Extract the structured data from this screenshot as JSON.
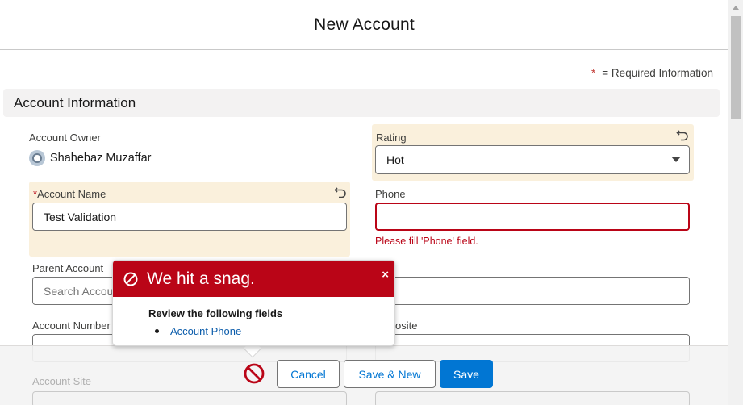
{
  "modal": {
    "title": "New Account"
  },
  "required_info": {
    "star": "*",
    "text": "= Required Information"
  },
  "section": {
    "title": "Account Information"
  },
  "fields": {
    "account_owner": {
      "label": "Account Owner",
      "value": "Shahebaz Muzaffar"
    },
    "rating": {
      "label": "Rating",
      "value": "Hot"
    },
    "account_name": {
      "required_star": "*",
      "label": "Account Name",
      "value": "Test Validation"
    },
    "phone": {
      "label": "Phone",
      "value": "",
      "error": "Please fill 'Phone' field."
    },
    "parent_account": {
      "label": "Parent Account",
      "placeholder": "Search Accou"
    },
    "account_number": {
      "label": "Account Number"
    },
    "website": {
      "label": "osite"
    },
    "account_site": {
      "label": "Account Site"
    }
  },
  "error_popover": {
    "title": "We hit a snag.",
    "close": "×",
    "body_title": "Review the following fields",
    "items": [
      "Account Phone"
    ]
  },
  "footer": {
    "cancel": "Cancel",
    "save_new": "Save & New",
    "save": "Save"
  },
  "colors": {
    "brand": "#0176d3",
    "error": "#ba0517",
    "highlight": "#faf0dc"
  }
}
